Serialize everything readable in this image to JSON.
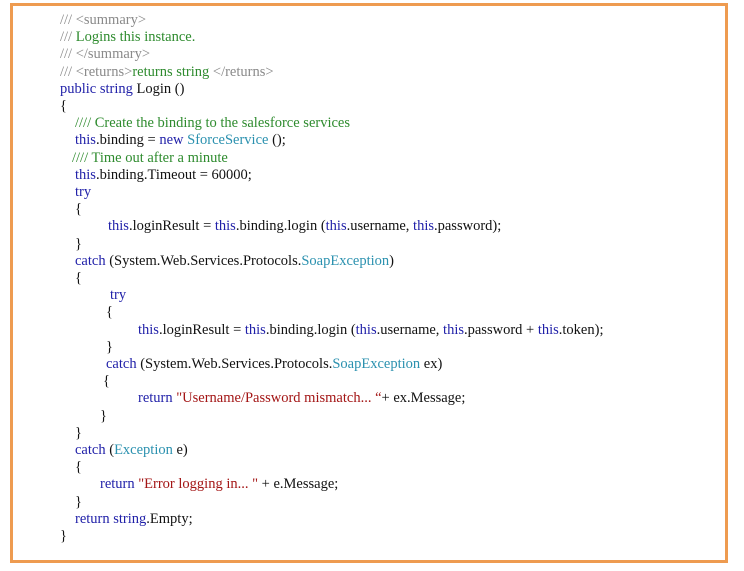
{
  "accent_border_color": "#ee9b50",
  "code_lines": [
    [
      [
        "cg",
        "/// <summary>"
      ]
    ],
    [
      [
        "cg",
        "/// "
      ],
      [
        "c",
        "Logins this instance."
      ]
    ],
    [
      [
        "cg",
        "/// </summary>"
      ]
    ],
    [
      [
        "cg",
        "/// <returns>"
      ],
      [
        "c",
        "returns string "
      ],
      [
        "cg",
        "</returns>"
      ]
    ],
    [
      [
        "k",
        "public string "
      ],
      [
        "x",
        "Login ()"
      ]
    ],
    [
      [
        "x",
        "{"
      ]
    ],
    [
      [
        "c",
        "//// Create the binding to the salesforce services"
      ]
    ],
    [
      [
        "k",
        "this"
      ],
      [
        "x",
        ".binding = "
      ],
      [
        "k",
        "new "
      ],
      [
        "ty",
        "SforceService"
      ],
      [
        "x",
        " ();"
      ]
    ],
    [
      [
        "c",
        "//// Time out after a minute"
      ]
    ],
    [
      [
        "k",
        "this"
      ],
      [
        "x",
        ".binding.Timeout = 60000;"
      ]
    ],
    [
      [
        "k",
        "try"
      ]
    ],
    [
      [
        "x",
        "{"
      ]
    ],
    [
      [
        "k",
        "this"
      ],
      [
        "x",
        ".loginResult = "
      ],
      [
        "k",
        "this"
      ],
      [
        "x",
        ".binding.login ("
      ],
      [
        "k",
        "this"
      ],
      [
        "x",
        ".username, "
      ],
      [
        "k",
        "this"
      ],
      [
        "x",
        ".password);"
      ]
    ],
    [
      [
        "x",
        "}"
      ]
    ],
    [
      [
        "k",
        "catch "
      ],
      [
        "x",
        "(System.Web.Services.Protocols."
      ],
      [
        "ty",
        "SoapException"
      ],
      [
        "x",
        ")"
      ]
    ],
    [
      [
        "x",
        "{"
      ]
    ],
    [
      [
        "k",
        "try"
      ]
    ],
    [
      [
        "x",
        "{"
      ]
    ],
    [
      [
        "k",
        "this"
      ],
      [
        "x",
        ".loginResult = "
      ],
      [
        "k",
        "this"
      ],
      [
        "x",
        ".binding.login ("
      ],
      [
        "k",
        "this"
      ],
      [
        "x",
        ".username, "
      ],
      [
        "k",
        "this"
      ],
      [
        "x",
        ".password + "
      ],
      [
        "k",
        "this"
      ],
      [
        "x",
        ".token);"
      ]
    ],
    [
      [
        "x",
        "}"
      ]
    ],
    [
      [
        "k",
        "catch "
      ],
      [
        "x",
        "(System.Web.Services.Protocols."
      ],
      [
        "ty",
        "SoapException"
      ],
      [
        "x",
        " ex)"
      ]
    ],
    [
      [
        "x",
        "{"
      ]
    ],
    [
      [
        "k",
        "return "
      ],
      [
        "s",
        "\"Username/Password mismatch... “"
      ],
      [
        "x",
        "+ ex.Message;"
      ]
    ],
    [
      [
        "x",
        "}"
      ]
    ],
    [
      [
        "x",
        "}"
      ]
    ],
    [
      [
        "k",
        "catch "
      ],
      [
        "x",
        "("
      ],
      [
        "ty",
        "Exception"
      ],
      [
        "x",
        " e)"
      ]
    ],
    [
      [
        "x",
        "{"
      ]
    ],
    [
      [
        "k",
        "return "
      ],
      [
        "s",
        "\"Error logging in... \""
      ],
      [
        "x",
        " + e.Message;"
      ]
    ],
    [
      [
        "x",
        "}"
      ]
    ],
    [
      [
        "k",
        "return string"
      ],
      [
        "x",
        ".Empty;"
      ]
    ],
    [
      [
        "x",
        "}"
      ]
    ]
  ]
}
